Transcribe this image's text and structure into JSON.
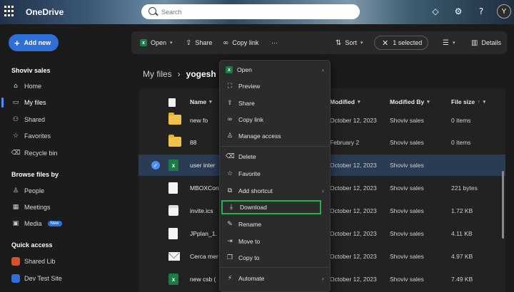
{
  "app": {
    "name": "OneDrive"
  },
  "search": {
    "placeholder": "Search"
  },
  "topbar": {
    "icons": [
      "settings-icon",
      "help-icon"
    ],
    "avatar_initial": "Y"
  },
  "sidebar": {
    "add_new": "Add new",
    "section1": "Shoviv sales",
    "items": [
      {
        "label": "Home",
        "icon": "home-icon"
      },
      {
        "label": "My files",
        "icon": "files-icon",
        "active": true
      },
      {
        "label": "Shared",
        "icon": "shared-icon"
      },
      {
        "label": "Favorites",
        "icon": "star-icon"
      },
      {
        "label": "Recycle bin",
        "icon": "trash-icon"
      }
    ],
    "section2": "Browse files by",
    "browse": [
      {
        "label": "People",
        "icon": "person-icon"
      },
      {
        "label": "Meetings",
        "icon": "calendar-icon"
      },
      {
        "label": "Media",
        "icon": "media-icon",
        "badge": "New"
      }
    ],
    "section3": "Quick access",
    "quick": [
      {
        "label": "Shared Lib",
        "color": "#d6512b"
      },
      {
        "label": "Dev Test Site",
        "color": "#2f6fd8"
      }
    ]
  },
  "commandbar": {
    "open": "Open",
    "share": "Share",
    "copy_link": "Copy link",
    "more": "···",
    "sort": "Sort",
    "selected": "1 selected",
    "details": "Details"
  },
  "breadcrumb": {
    "root": "My files",
    "separator": "›",
    "current": "yogesh"
  },
  "columns": {
    "name": "Name",
    "modified": "Modified",
    "modified_by": "Modified By",
    "file_size": "File size"
  },
  "files": [
    {
      "type": "folder",
      "name": "new fo",
      "modified": "October 12, 2023",
      "by": "Shoviv sales",
      "size": "0 items"
    },
    {
      "type": "folder",
      "name": "88",
      "modified": "February 2",
      "by": "Shoviv sales",
      "size": "0 items"
    },
    {
      "type": "excel",
      "name": "user inter",
      "modified": "October 12, 2023",
      "by": "Shoviv sales",
      "size": "",
      "selected": true
    },
    {
      "type": "doc",
      "name": "MBOXCon",
      "modified": "October 12, 2023",
      "by": "Shoviv sales",
      "size": "221 bytes"
    },
    {
      "type": "calendar",
      "name": "invite.ics",
      "modified": "October 12, 2023",
      "by": "Shoviv sales",
      "size": "1.72 KB"
    },
    {
      "type": "doc",
      "name": "JPplan_1.",
      "modified": "October 12, 2023",
      "by": "Shoviv sales",
      "size": "4.11 KB"
    },
    {
      "type": "mail",
      "name": "Cerca mer",
      "modified": "October 12, 2023",
      "by": "Shoviv sales",
      "size": "4.97 KB"
    },
    {
      "type": "excel",
      "name": "new csb (",
      "modified": "October 12, 2023",
      "by": "Shoviv sales",
      "size": "7.49 KB"
    }
  ],
  "context_menu": {
    "items": [
      {
        "label": "Open",
        "icon": "excel-icon",
        "submenu": true
      },
      {
        "label": "Preview",
        "icon": "preview-icon"
      },
      {
        "label": "Share",
        "icon": "share-icon"
      },
      {
        "label": "Copy link",
        "icon": "link-icon"
      },
      {
        "label": "Manage access",
        "icon": "manage-access-icon"
      },
      {
        "label": "Delete",
        "icon": "trash-icon"
      },
      {
        "label": "Favorite",
        "icon": "star-icon"
      },
      {
        "label": "Add shortcut",
        "icon": "add-shortcut-icon",
        "submenu": true
      },
      {
        "label": "Download",
        "icon": "download-icon",
        "highlighted": true
      },
      {
        "label": "Rename",
        "icon": "rename-icon"
      },
      {
        "label": "Move to",
        "icon": "move-icon"
      },
      {
        "label": "Copy to",
        "icon": "copy-icon"
      },
      {
        "label": "Automate",
        "icon": "automate-icon",
        "submenu": true
      }
    ],
    "highlight_color": "#22b14c"
  },
  "colors": {
    "accent": "#2f6fd8",
    "selected_row": "#2a3b54",
    "excel": "#1d7b45",
    "folder": "#f2c14a"
  }
}
